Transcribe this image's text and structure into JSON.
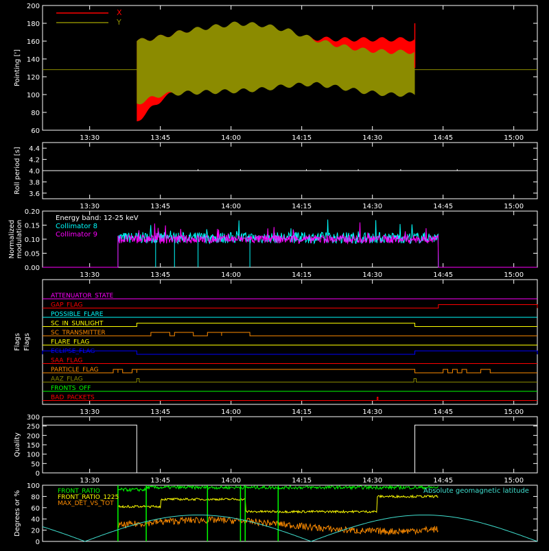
{
  "colors": {
    "background": "#000000",
    "axis": "#ffffff",
    "red": "#ff0000",
    "olive": "#8b8b00",
    "cyan": "#00ffff",
    "magenta": "#ff00ff",
    "yellow": "#ffff00",
    "green": "#00ff00",
    "orange": "#ff8c00",
    "blue": "#0000ff",
    "lightcyan": "#40e0d0"
  },
  "chart_data": [
    {
      "type": "line",
      "ylabel": "Pointing [']",
      "ylim": [
        60,
        200
      ],
      "yticks": [
        "60",
        "80",
        "100",
        "120",
        "140",
        "160",
        "180",
        "200"
      ],
      "xlim": [
        "13:20",
        "15:05"
      ],
      "xticks": [
        "13:30",
        "13:45",
        "14:00",
        "14:15",
        "14:30",
        "14:45",
        "15:00"
      ],
      "series": [
        {
          "name": "X",
          "color": "#ff0000",
          "t_start": "13:40",
          "t_end": "14:39",
          "envelope_max": [
            160,
            165,
            172,
            174,
            170,
            168,
            165,
            163,
            162,
            162,
            162,
            162
          ],
          "envelope_min": [
            70,
            95,
            110,
            118,
            120,
            122,
            122,
            120,
            120,
            120,
            120,
            120
          ]
        },
        {
          "name": "Y",
          "color": "#8b8b00",
          "t_start": "13:40",
          "t_end": "14:39",
          "envelope_max": [
            160,
            165,
            172,
            176,
            180,
            178,
            172,
            162,
            155,
            150,
            148,
            148
          ],
          "envelope_min": [
            90,
            100,
            102,
            103,
            104,
            106,
            110,
            112,
            108,
            103,
            100,
            100
          ],
          "baseline": 128
        }
      ],
      "legend": "top-left"
    },
    {
      "type": "line",
      "ylabel": "Roll period [s]",
      "ylim": [
        3.5,
        4.5
      ],
      "yticks": [
        "3.6",
        "3.8",
        "4.0",
        "4.2",
        "4.4"
      ],
      "xticks": [
        "13:30",
        "13:45",
        "14:00",
        "14:15",
        "14:30",
        "14:45",
        "15:00"
      ],
      "series": [
        {
          "values_constant": 4.0,
          "color": "#ffffff"
        }
      ]
    },
    {
      "type": "line",
      "ylabel": "Normalized modulation",
      "ylim": [
        0,
        0.2
      ],
      "yticks": [
        "0.00",
        "0.05",
        "0.10",
        "0.15",
        "0.20"
      ],
      "xticks": [
        "13:30",
        "13:45",
        "14:00",
        "14:15",
        "14:30",
        "14:45",
        "15:00"
      ],
      "annotation": "Energy band: 12-25 keV",
      "series": [
        {
          "name": "Collimator 8",
          "color": "#00ffff",
          "t_start": "13:36",
          "t_end": "14:44",
          "mean": 0.105,
          "noise": 0.02
        },
        {
          "name": "Collimator 9",
          "color": "#ff00ff",
          "t_start": "13:36",
          "t_end": "14:44",
          "mean": 0.1,
          "noise": 0.015
        }
      ],
      "dips_time": [
        "13:44",
        "13:48",
        "13:53",
        "14:04"
      ],
      "legend": "top-left"
    },
    {
      "type": "line",
      "ylabel": "Flags",
      "xticks": [
        "13:30",
        "13:45",
        "14:00",
        "14:15",
        "14:30",
        "14:45",
        "15:00"
      ],
      "flags": [
        {
          "name": "ATTENUATOR_STATE",
          "color": "#ff00ff",
          "segments": []
        },
        {
          "name": "GAP_FLAG",
          "color": "#ff0000",
          "segments": [
            [
              "14:44",
              "15:05"
            ]
          ]
        },
        {
          "name": "POSSIBLE_FLARE",
          "color": "#00ffff",
          "segments": []
        },
        {
          "name": "SC_IN_SUNLIGHT",
          "color": "#ffff00",
          "segments": [
            [
              "13:40",
              "14:39"
            ]
          ]
        },
        {
          "name": "SC_TRANSMITTER",
          "color": "#ff8c00",
          "segments": [
            [
              "13:43",
              "13:47"
            ],
            [
              "13:48",
              "13:52"
            ],
            [
              "13:55",
              "13:58"
            ],
            [
              "13:58",
              "14:04"
            ]
          ]
        },
        {
          "name": "FLARE_FLAG",
          "color": "#ffff00",
          "segments": []
        },
        {
          "name": "ECLIPSE_FLAG",
          "color": "#0000ff",
          "segments": [
            [
              "13:20",
              "13:40"
            ],
            [
              "14:39",
              "15:05"
            ]
          ]
        },
        {
          "name": "SAA_FLAG",
          "color": "#ff0000",
          "segments": []
        },
        {
          "name": "PARTICLE_FLAG",
          "color": "#ff8c00",
          "segments": [
            [
              "13:35",
              "13:36"
            ],
            [
              "13:36",
              "13:37"
            ],
            [
              "13:39",
              "13:40"
            ],
            [
              "13:40",
              "14:39"
            ],
            [
              "14:45",
              "14:46"
            ],
            [
              "14:47",
              "14:48"
            ],
            [
              "14:49",
              "14:50"
            ],
            [
              "14:53",
              "14:55"
            ]
          ]
        },
        {
          "name": "AAZ_FLAG",
          "color": "#8b8b00",
          "segments": [
            [
              "13:40",
              "13:40.5"
            ],
            [
              "14:38.8",
              "14:39.3"
            ]
          ]
        },
        {
          "name": "FRONTS_OFF",
          "color": "#00ff00",
          "segments": []
        },
        {
          "name": "BAD_PACKETS",
          "color": "#ff0000",
          "segments": [
            [
              "14:31",
              "14:31.2"
            ]
          ]
        }
      ]
    },
    {
      "type": "line",
      "ylabel": "Quality",
      "ylim": [
        0,
        300
      ],
      "yticks": [
        "0",
        "50",
        "100",
        "150",
        "200",
        "250",
        "300"
      ],
      "xticks": [
        "13:30",
        "13:45",
        "14:00",
        "14:15",
        "14:30",
        "14:45",
        "15:00"
      ],
      "series": [
        {
          "color": "#ffffff",
          "points": [
            [
              "13:20",
              255
            ],
            [
              "13:40",
              255
            ],
            [
              "13:40",
              0
            ],
            [
              "14:39",
              0
            ],
            [
              "14:39",
              255
            ],
            [
              "15:05",
              255
            ]
          ]
        }
      ]
    },
    {
      "type": "line",
      "ylabel": "Degrees or %",
      "ylim": [
        0,
        100
      ],
      "yticks": [
        "0",
        "20",
        "40",
        "60",
        "80",
        "100"
      ],
      "series": [
        {
          "name": "FRONT_RATIO",
          "color": "#00ff00",
          "t_start": "13:36",
          "t_end": "14:44",
          "level": 93
        },
        {
          "name": "FRONT_RATIO_1225",
          "color": "#ffff00",
          "t_start": "13:36",
          "t_end": "14:44",
          "level": 70
        },
        {
          "name": "MAX_DET_VS_TOT",
          "color": "#ff8c00",
          "t_start": "13:36",
          "t_end": "14:44",
          "level": 28
        },
        {
          "name": "Absolute geomagnetic latitude",
          "color": "#40e0d0",
          "shape": "abs-sine",
          "amplitude": 47
        }
      ],
      "legend": "top-left"
    }
  ]
}
